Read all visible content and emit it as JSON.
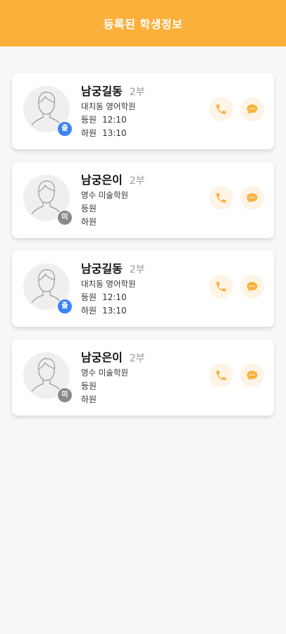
{
  "header": {
    "title": "등록된 학생정보"
  },
  "colors": {
    "accent": "#fbb03b",
    "badge_attend": "#3b82f6",
    "badge_absent": "#8a8a8a"
  },
  "students": [
    {
      "name": "남궁길동",
      "class": "2부",
      "academy": "대치동 영어학원",
      "badge": "출",
      "badge_type": "attend",
      "arrive_label": "등원",
      "arrive_time": "12:10",
      "leave_label": "하원",
      "leave_time": "13:10",
      "call_icon": "phone-icon",
      "message_icon": "chat-icon"
    },
    {
      "name": "남궁은이",
      "class": "2부",
      "academy": "영수 미술학원",
      "badge": "미",
      "badge_type": "absent",
      "arrive_label": "등원",
      "arrive_time": "",
      "leave_label": "하원",
      "leave_time": "",
      "call_icon": "phone-icon",
      "message_icon": "chat-icon"
    },
    {
      "name": "남궁길동",
      "class": "2부",
      "academy": "대치동 영어학원",
      "badge": "출",
      "badge_type": "attend",
      "arrive_label": "등원",
      "arrive_time": "12:10",
      "leave_label": "하원",
      "leave_time": "13:10",
      "call_icon": "phone-icon",
      "message_icon": "chat-icon"
    },
    {
      "name": "남궁은이",
      "class": "2부",
      "academy": "영수 미술학원",
      "badge": "미",
      "badge_type": "absent",
      "arrive_label": "등원",
      "arrive_time": "",
      "leave_label": "하원",
      "leave_time": "",
      "call_icon": "phone-icon",
      "message_icon": "chat-icon"
    }
  ]
}
